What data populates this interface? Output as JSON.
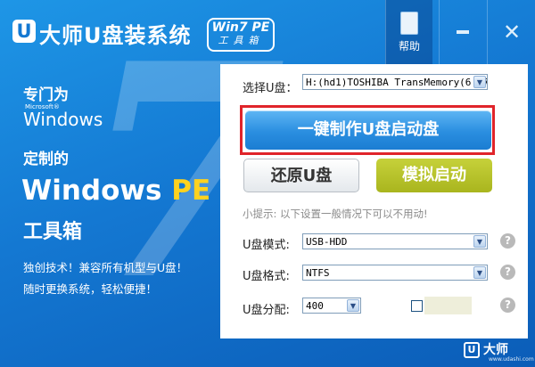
{
  "title_bar": {
    "logo_letter": "U",
    "app_title": "大师U盘装系统",
    "edition_top": "Win7 PE",
    "edition_bottom": "工具箱",
    "help_label": "帮助",
    "help_icon": "book-icon",
    "minimize_icon": "minimize-icon",
    "close_icon": "close-icon",
    "close_glyph": "✕"
  },
  "left_panel": {
    "tagline_for": "专门为",
    "microsoft_small": "Microsoft®",
    "windows_word": "Windows",
    "big_number": "7",
    "tagline_custom": "定制的",
    "winpe_windows": "Windows",
    "winpe_pe": "PE",
    "toolbox": "工具箱",
    "promo_line1": "独创技术！兼容所有机型与U盘！",
    "promo_line2": "随时更换系统，轻松便捷！"
  },
  "main": {
    "select_label": "选择U盘：",
    "select_value": "H:(hd1)TOSHIBA TransMemory(6.87",
    "make_button": "一键制作U盘启动盘",
    "restore_button": "还原U盘",
    "emulate_button": "模拟启动",
    "tip": "小提示: 以下设置一般情况下可以不用动!",
    "mode_label": "U盘模式:",
    "mode_value": "USB-HDD",
    "format_label": "U盘格式:",
    "format_value": "NTFS",
    "alloc_label": "U盘分配:",
    "alloc_value": "400",
    "help_glyph": "?",
    "dropdown_glyph": "▼"
  },
  "colors": {
    "window_blue": "#1478d2",
    "highlight_red": "#e0242a",
    "emulate_green": "#a9b51e",
    "pe_yellow": "#ffd21e"
  },
  "footer": {
    "logo_letter": "U",
    "brand": "大师",
    "url": "www.udashi.com"
  }
}
